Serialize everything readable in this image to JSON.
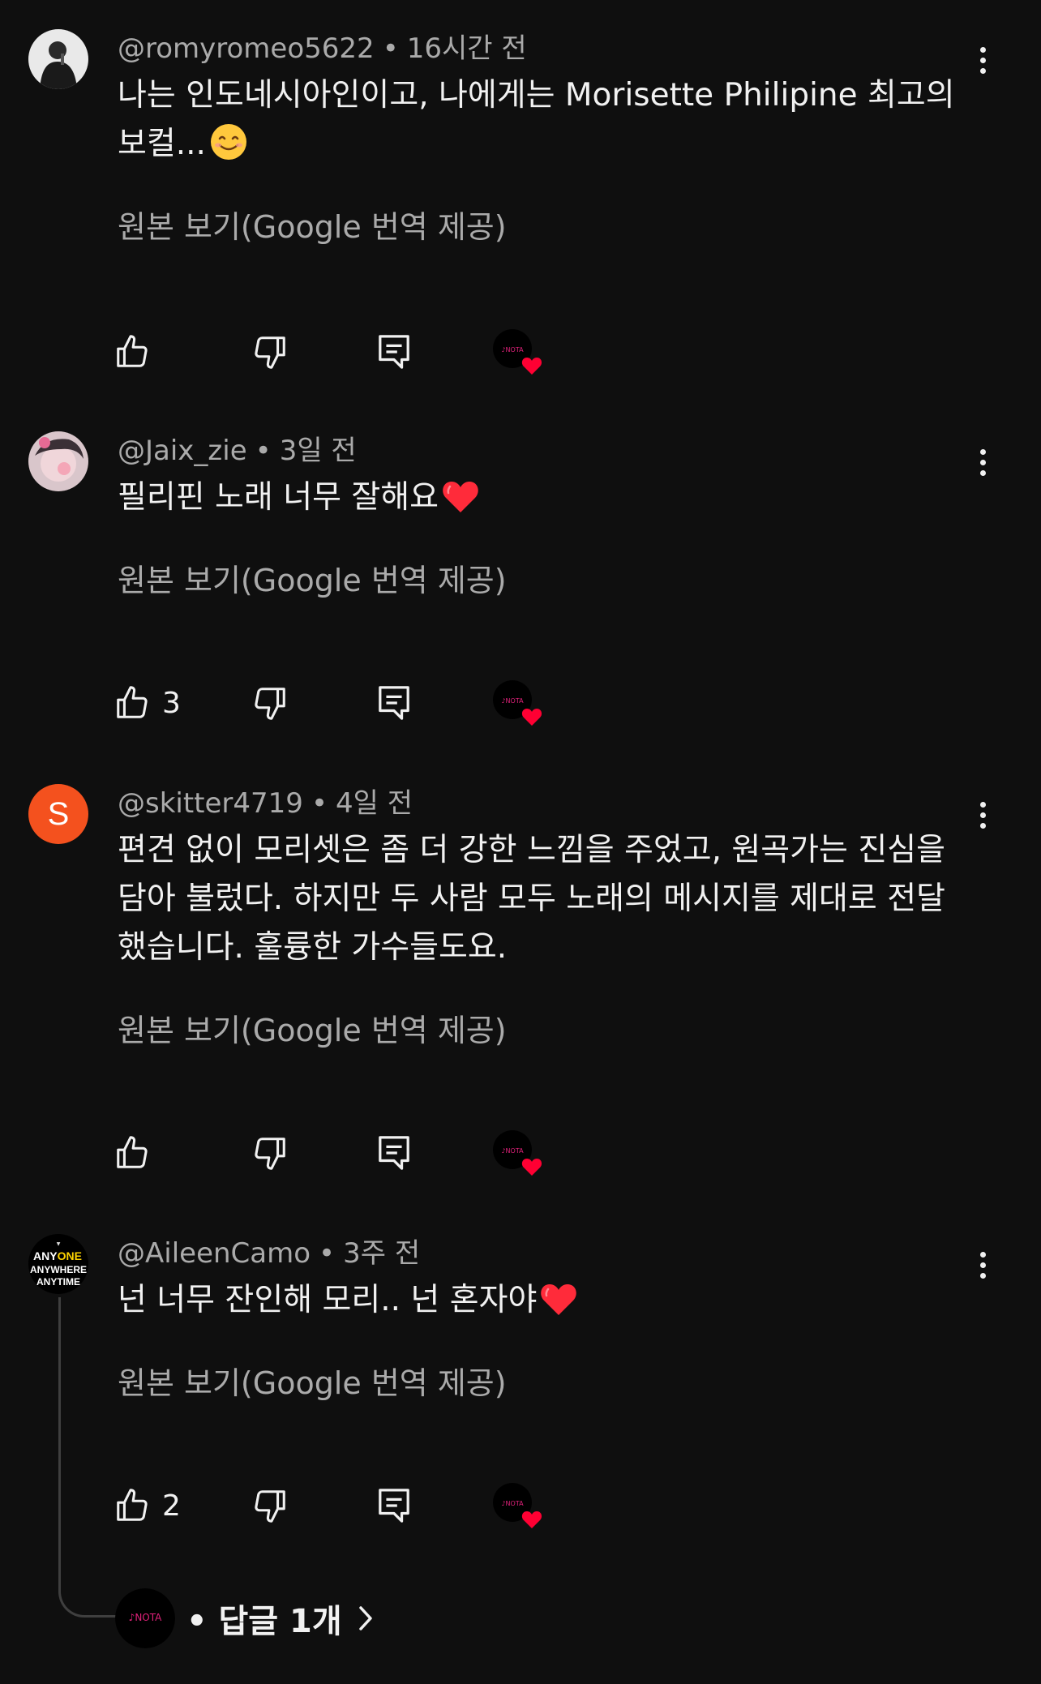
{
  "comments": [
    {
      "handle": "@romyromeo5622",
      "time": "16시간 전",
      "text": "나는 인도네시아인이고, 나에게는 Morisette Philipine 최고의\n보컬...",
      "emoji": "smile",
      "translate_label": "원본 보기(Google 번역 제공)",
      "like_count": "",
      "avatar_icon": "person-photo-avatar"
    },
    {
      "handle": "@Jaix_zie",
      "time": "3일 전",
      "text": "필리핀 노래 너무 잘해요",
      "emoji": "heart",
      "translate_label": "원본 보기(Google 번역 제공)",
      "like_count": "3",
      "avatar_icon": "pink-photo-avatar"
    },
    {
      "handle": "@skitter4719",
      "time": "4일 전",
      "text": "편견 없이 모리셋은 좀 더 강한 느낌을 주었고, 원곡가는 진심을\n담아 불렀다. 하지만 두 사람 모두 노래의 메시지를 제대로 전달\n했습니다. 훌륭한 가수들도요.",
      "emoji": "",
      "translate_label": "원본 보기(Google 번역 제공)",
      "like_count": "",
      "avatar_letter": "S",
      "avatar_color": "#f4511e"
    },
    {
      "handle": "@AileenCamo",
      "time": "3주 전",
      "text": "넌 너무 잔인해 모리.. 넌 혼자야",
      "emoji": "heart",
      "translate_label": "원본 보기(Google 번역 제공)",
      "like_count": "2",
      "avatar_icon": "anyone-anywhere-logo-avatar"
    }
  ],
  "replies": {
    "label": "• 답글 1개",
    "chevron_icon": "chevron-right-icon"
  },
  "channel_logo_text": "NOTA",
  "colors": {
    "background": "#0f0f0f",
    "primary_text": "#f1f1f1",
    "secondary_text": "#aaaaaa",
    "heart": "#ff0033",
    "nota_pink": "#e0217a"
  }
}
